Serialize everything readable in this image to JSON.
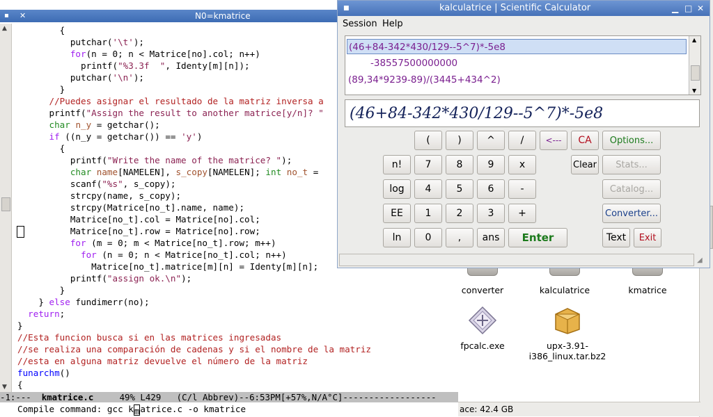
{
  "emacs": {
    "title": "N0=kmatrice",
    "code_lines": [
      [
        {
          "t": "        {",
          "c": "#000"
        }
      ],
      [
        {
          "t": "          putchar(",
          "c": "#000"
        },
        {
          "t": "'\\t'",
          "c": "#8b2252"
        },
        {
          "t": ");",
          "c": "#000"
        }
      ],
      [
        {
          "t": "          ",
          "c": "#000"
        },
        {
          "t": "for",
          "c": "#a020f0"
        },
        {
          "t": "(n = 0; n < Matrice[no].col; n++)",
          "c": "#000"
        }
      ],
      [
        {
          "t": "            printf(",
          "c": "#000"
        },
        {
          "t": "\"%3.3f  \"",
          "c": "#8b2252"
        },
        {
          "t": ", Identy[m][n]);",
          "c": "#000"
        }
      ],
      [
        {
          "t": "          putchar(",
          "c": "#000"
        },
        {
          "t": "'\\n'",
          "c": "#8b2252"
        },
        {
          "t": ");",
          "c": "#000"
        }
      ],
      [
        {
          "t": "        }",
          "c": "#000"
        }
      ],
      [
        {
          "t": "      ",
          "c": "#000"
        },
        {
          "t": "//Puedes asignar el resultado de la matriz inversa a",
          "c": "#b22222"
        }
      ],
      [
        {
          "t": "      printf(",
          "c": "#000"
        },
        {
          "t": "\"Assign the result to another matrice[y/n]? \"",
          "c": "#8b2252"
        }
      ],
      [
        {
          "t": "      ",
          "c": "#000"
        },
        {
          "t": "char",
          "c": "#228b22"
        },
        {
          "t": " ",
          "c": "#000"
        },
        {
          "t": "n_y",
          "c": "#a0522d"
        },
        {
          "t": " = getchar();",
          "c": "#000"
        }
      ],
      [
        {
          "t": "      ",
          "c": "#000"
        },
        {
          "t": "if",
          "c": "#a020f0"
        },
        {
          "t": " ((n_y = getchar()) == ",
          "c": "#000"
        },
        {
          "t": "'y'",
          "c": "#8b2252"
        },
        {
          "t": ")",
          "c": "#000"
        }
      ],
      [
        {
          "t": "        {",
          "c": "#000"
        }
      ],
      [
        {
          "t": "          printf(",
          "c": "#000"
        },
        {
          "t": "\"Write the name of the matrice? \"",
          "c": "#8b2252"
        },
        {
          "t": ");",
          "c": "#000"
        }
      ],
      [
        {
          "t": "          ",
          "c": "#000"
        },
        {
          "t": "char",
          "c": "#228b22"
        },
        {
          "t": " ",
          "c": "#000"
        },
        {
          "t": "name",
          "c": "#a0522d"
        },
        {
          "t": "[NAMELEN], ",
          "c": "#000"
        },
        {
          "t": "s_copy",
          "c": "#a0522d"
        },
        {
          "t": "[NAMELEN]; ",
          "c": "#000"
        },
        {
          "t": "int",
          "c": "#228b22"
        },
        {
          "t": " ",
          "c": "#000"
        },
        {
          "t": "no_t",
          "c": "#a0522d"
        },
        {
          "t": " =",
          "c": "#000"
        }
      ],
      [
        {
          "t": "          scanf(",
          "c": "#000"
        },
        {
          "t": "\"%s\"",
          "c": "#8b2252"
        },
        {
          "t": ", s_copy);",
          "c": "#000"
        }
      ],
      [
        {
          "t": "          strcpy(name, s_copy);",
          "c": "#000"
        }
      ],
      [
        {
          "t": "          strcpy(Matrice[no_t].name, name);",
          "c": "#000"
        }
      ],
      [
        {
          "t": "          Matrice[no_t].col = Matrice[no].col;",
          "c": "#000"
        }
      ],
      [
        {
          "t": "          Matrice[no_t].row = Matrice[no].row;",
          "c": "#000"
        }
      ],
      [
        {
          "t": "          ",
          "c": "#000"
        },
        {
          "t": "for",
          "c": "#a020f0"
        },
        {
          "t": " (m = 0; m < Matrice[no_t].row; m++)",
          "c": "#000"
        }
      ],
      [
        {
          "t": "            ",
          "c": "#000"
        },
        {
          "t": "for",
          "c": "#a020f0"
        },
        {
          "t": " (n = 0; n < Matrice[no_t].col; n++)",
          "c": "#000"
        }
      ],
      [
        {
          "t": "              Matrice[no_t].matrice[m][n] = Identy[m][n];",
          "c": "#000"
        }
      ],
      [
        {
          "t": "          printf(",
          "c": "#000"
        },
        {
          "t": "\"assign ok.\\n\"",
          "c": "#8b2252"
        },
        {
          "t": ");",
          "c": "#000"
        }
      ],
      [
        {
          "t": "        }",
          "c": "#000"
        }
      ],
      [
        {
          "t": "    } ",
          "c": "#000"
        },
        {
          "t": "else",
          "c": "#a020f0"
        },
        {
          "t": " fundimerr(no);",
          "c": "#000"
        }
      ],
      [
        {
          "t": "  ",
          "c": "#000"
        },
        {
          "t": "return",
          "c": "#a020f0"
        },
        {
          "t": ";",
          "c": "#000"
        }
      ],
      [
        {
          "t": "}",
          "c": "#000"
        }
      ],
      [
        {
          "t": "//Esta funcion busca si en las matrices ingresadas",
          "c": "#b22222"
        }
      ],
      [
        {
          "t": "//se realiza una comparación de cadenas y si el nombre de la matriz",
          "c": "#b22222"
        }
      ],
      [
        {
          "t": "//esta en alguna matriz devuelve el número de la matriz",
          "c": "#b22222"
        }
      ],
      [
        {
          "t": "funarchm",
          "c": "#0000ff"
        },
        {
          "t": "()",
          "c": "#000"
        }
      ],
      [
        {
          "t": "{",
          "c": "#000"
        }
      ]
    ],
    "modeline": {
      "prefix": "-1:---  ",
      "buffer": "kmatrice.c",
      "rest": "     49% L429   (C/l Abbrev)--6:53PM[+57%,N/A°C]------------------"
    },
    "minibuffer": {
      "prompt": "Compile command: ",
      "before_cursor": "gcc k",
      "cursor_char": "m",
      "after_cursor": "atrice.c -o kmatrice"
    }
  },
  "calculator": {
    "title": "kalculatrice | Scientific Calculator",
    "menu": [
      "Session",
      "Help"
    ],
    "history": [
      {
        "text": "(46+84-342*430/129--5^7)*-5e8",
        "kind": "expr",
        "selected": true
      },
      {
        "text": "-38557500000000",
        "kind": "result",
        "selected": false
      },
      {
        "text": "(89,34*9239-89)/(3445+434^2)",
        "kind": "expr",
        "selected": false
      }
    ],
    "display": "(46+84-342*430/129--5^7)*-5e8",
    "keys": {
      "lparen": "(",
      "rparen": ")",
      "pow": "^",
      "div": "/",
      "back": "<---",
      "ca": "CA",
      "options": "Options...",
      "fact": "n!",
      "k7": "7",
      "k8": "8",
      "k9": "9",
      "mul": "x",
      "clear": "Clear",
      "stats": "Stats...",
      "log": "log",
      "k4": "4",
      "k5": "5",
      "k6": "6",
      "minus": "-",
      "catalog": "Catalog...",
      "ee": "EE",
      "k1": "1",
      "k2": "2",
      "k3": "3",
      "plus": "+",
      "converter": "Converter...",
      "ln": "ln",
      "k0": "0",
      "comma": ",",
      "ans": "ans",
      "enter": "Enter",
      "text": "Text",
      "exit": "Exit"
    }
  },
  "file_manager": {
    "items": [
      {
        "label": "converter"
      },
      {
        "label": "kalculatrice"
      },
      {
        "label": "kmatrice"
      },
      {
        "label": "fpcalc.exe"
      },
      {
        "label_line1": "upx-3.91-",
        "label_line2": "i386_linux.tar.bz2"
      }
    ],
    "status": "ace: 42.4 GB"
  }
}
